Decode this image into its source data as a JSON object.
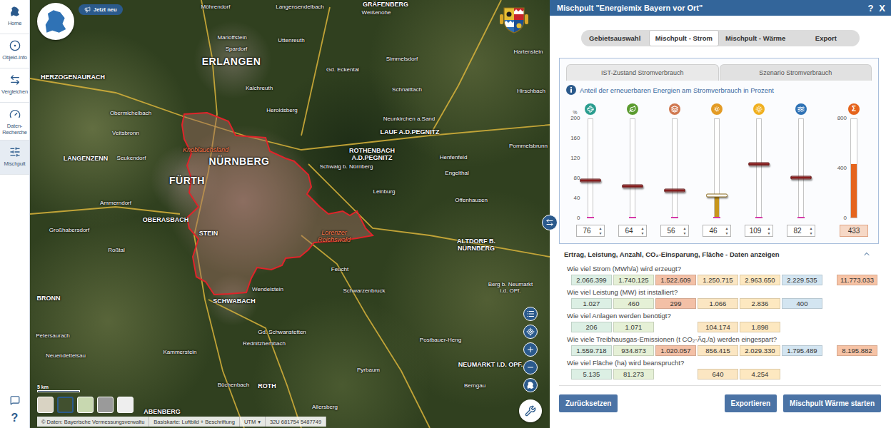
{
  "sidebar": {
    "items": [
      {
        "label": "Home",
        "selected": false
      },
      {
        "label": "Objekt-Info",
        "selected": false
      },
      {
        "label": "Vergleichen",
        "selected": false
      },
      {
        "label": "Daten-Recherche",
        "selected": false
      },
      {
        "label": "Mischpult",
        "selected": true
      }
    ],
    "help": "?"
  },
  "map": {
    "badge": "Jetzt neu",
    "labels": [
      {
        "text": "Möhrendorf",
        "kind": "village"
      },
      {
        "text": "Langensendelbach",
        "kind": "village"
      },
      {
        "text": "GRÄFENBERG",
        "kind": "town"
      },
      {
        "text": "Weißenohe",
        "kind": "village"
      },
      {
        "text": "Marloffstein",
        "kind": "village"
      },
      {
        "text": "Uttenreuth",
        "kind": "village"
      },
      {
        "text": "Spardorf",
        "kind": "village"
      },
      {
        "text": "ERLANGEN",
        "kind": "city"
      },
      {
        "text": "Hartenstein",
        "kind": "village"
      },
      {
        "text": "Simmelsdorf",
        "kind": "village"
      },
      {
        "text": "Gd. Eckental",
        "kind": "village"
      },
      {
        "text": "HERZOGENAURACH",
        "kind": "town"
      },
      {
        "text": "Kalchreuth",
        "kind": "village"
      },
      {
        "text": "Schnaittach",
        "kind": "village"
      },
      {
        "text": "Hirschbach",
        "kind": "village"
      },
      {
        "text": "Heroldsberg",
        "kind": "village"
      },
      {
        "text": "Obermichelbach",
        "kind": "village"
      },
      {
        "text": "Neunkirchen a.Sand",
        "kind": "village"
      },
      {
        "text": "Veitsbronn",
        "kind": "village"
      },
      {
        "text": "LAUF A.D.PEGNITZ",
        "kind": "town"
      },
      {
        "text": "Pommelsbrunn",
        "kind": "village"
      },
      {
        "text": "Knoblauchsland",
        "kind": "area"
      },
      {
        "text": "ROTHENBACH A.D.PEGNITZ",
        "kind": "town"
      },
      {
        "text": "Henfenfeld",
        "kind": "village"
      },
      {
        "text": "LANGENZENN",
        "kind": "town"
      },
      {
        "text": "Seukendorf",
        "kind": "village"
      },
      {
        "text": "NÜRNBERG",
        "kind": "city"
      },
      {
        "text": "Schwaig b. Nürnberg",
        "kind": "village"
      },
      {
        "text": "Engelthal",
        "kind": "village"
      },
      {
        "text": "FÜRTH",
        "kind": "city"
      },
      {
        "text": "Leinburg",
        "kind": "village"
      },
      {
        "text": "Offenhausen",
        "kind": "village"
      },
      {
        "text": "Ammerndorf",
        "kind": "village"
      },
      {
        "text": "OBERASBACH",
        "kind": "town"
      },
      {
        "text": "Großhabersdorf",
        "kind": "village"
      },
      {
        "text": "STEIN",
        "kind": "town"
      },
      {
        "text": "Lorenzer Reichswald",
        "kind": "area"
      },
      {
        "text": "ALTDORF B. NÜRNBERG",
        "kind": "town"
      },
      {
        "text": "Roßtal",
        "kind": "village"
      },
      {
        "text": "Feucht",
        "kind": "village"
      },
      {
        "text": "Wendelstein",
        "kind": "village"
      },
      {
        "text": "Schwarzenbruck",
        "kind": "village"
      },
      {
        "text": "Berg b. Neumarkt i.d. OPf.",
        "kind": "village"
      },
      {
        "text": "BRONN",
        "kind": "town"
      },
      {
        "text": "SCHWABACH",
        "kind": "town"
      },
      {
        "text": "Gd. Schwanstetten",
        "kind": "village"
      },
      {
        "text": "Petersaurach",
        "kind": "village"
      },
      {
        "text": "Postbauer-Heng",
        "kind": "village"
      },
      {
        "text": "Rednitzhembach",
        "kind": "village"
      },
      {
        "text": "Kammerstein",
        "kind": "village"
      },
      {
        "text": "Neuendettelsau",
        "kind": "village"
      },
      {
        "text": "NEUMARKT I.D. OPF.",
        "kind": "town"
      },
      {
        "text": "Pyrbaum",
        "kind": "village"
      },
      {
        "text": "Büchenbach",
        "kind": "village"
      },
      {
        "text": "ROTH",
        "kind": "town"
      },
      {
        "text": "Berngau",
        "kind": "village"
      },
      {
        "text": "Allersberg",
        "kind": "village"
      },
      {
        "text": "ABENBERG",
        "kind": "town"
      }
    ],
    "scale": "5 km",
    "basemaps": [
      {
        "selected": false
      },
      {
        "selected": true
      },
      {
        "selected": false
      },
      {
        "selected": false
      },
      {
        "selected": false
      }
    ],
    "attribution": "© Daten: Bayerische Vermessungsverwaltu",
    "basemap_label": "Basiskarte: Luftbild + Beschriftung",
    "projection": "UTM",
    "projection_arrow": "▾",
    "coordinates": "32U 681754 5487749"
  },
  "panel": {
    "title": "Mischpult \"Energiemix Bayern vor Ort\"",
    "help": "?",
    "close": "X",
    "tabs": [
      {
        "label": "Gebietsauswahl",
        "selected": false
      },
      {
        "label": "Mischpult - Strom",
        "selected": true
      },
      {
        "label": "Mischpult - Wärme",
        "selected": false
      },
      {
        "label": "Export",
        "selected": false
      }
    ],
    "subtabs": [
      {
        "label": "IST-Zustand Stromverbrauch",
        "selected": true
      },
      {
        "label": "Szenario Stromverbrauch",
        "selected": false
      }
    ],
    "info": "Anteil der erneuerbaren Energien am Stromverbrauch in Prozent",
    "axis": {
      "unit": "%",
      "ticks": [
        "200",
        "160",
        "120",
        "80",
        "40",
        "0"
      ]
    },
    "sum_axis": {
      "ticks": [
        "800",
        "400",
        "0"
      ]
    },
    "spin": {
      "up": "▲",
      "down": "▼"
    },
    "sources": [
      {
        "value": "76",
        "level": 0.38,
        "active": false,
        "color": "#2a9d8f",
        "cell_color": "#dcefe4"
      },
      {
        "value": "64",
        "level": 0.32,
        "active": false,
        "color": "#5b9b2f",
        "cell_color": "#e5f0d6"
      },
      {
        "value": "56",
        "level": 0.28,
        "active": false,
        "color": "#d07850",
        "cell_color": "#f3c0a6"
      },
      {
        "value": "46",
        "level": 0.23,
        "active": true,
        "color": "#e39b25",
        "cell_color": "#fbe6c2"
      },
      {
        "value": "109",
        "level": 0.545,
        "active": false,
        "color": "#f0b020",
        "cell_color": "#fde8c0"
      },
      {
        "value": "82",
        "level": 0.41,
        "active": false,
        "color": "#2f72b5",
        "cell_color": "#d3e5f1"
      }
    ],
    "sum": {
      "symbol": "Σ",
      "value": "433",
      "level": 0.54125,
      "color": "#e5641d",
      "cell_color": "#f7c3a5"
    },
    "details": {
      "title": "Ertrag, Leistung, Anzahl, CO₂-Einsparung, Fläche - Daten anzeigen",
      "expanded": true
    },
    "metrics": [
      {
        "question": "Wie viel Strom (MWh/a) wird erzeugt?",
        "cells": [
          "2.066.399",
          "1.740.125",
          "1.522.609",
          "1.250.715",
          "2.963.650",
          "2.229.535",
          "11.773.033"
        ]
      },
      {
        "question": "Wie viel Leistung (MW) ist installiert?",
        "cells": [
          "1.027",
          "460",
          "299",
          "1.066",
          "2.836",
          "400",
          null
        ]
      },
      {
        "question": "Wie viel Anlagen werden benötigt?",
        "cells": [
          "206",
          "1.071",
          null,
          "104.174",
          "1.898",
          null,
          null
        ]
      },
      {
        "question": "Wie viele Treibhausgas-Emissionen (t CO₂-Äq./a) werden eingespart?",
        "cells": [
          "1.559.718",
          "934.873",
          "1.020.057",
          "856.415",
          "2.029.330",
          "1.795.489",
          "8.195.882"
        ]
      },
      {
        "question": "Wie viel Fläche (ha) wird beansprucht?",
        "cells": [
          "5.135",
          "81.273",
          null,
          "640",
          "4.254",
          null,
          null
        ]
      }
    ],
    "buttons": {
      "reset": "Zurücksetzen",
      "export": "Exportieren",
      "start": "Mischpult Wärme starten"
    }
  }
}
